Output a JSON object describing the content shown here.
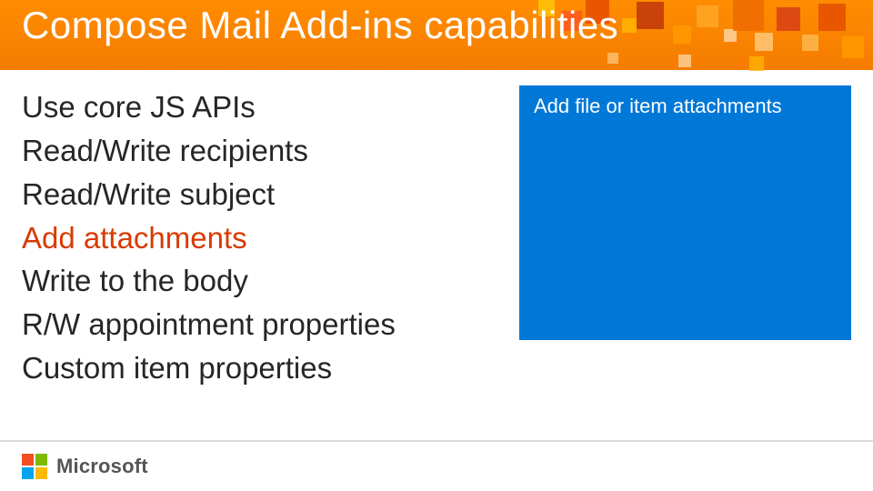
{
  "title": "Compose Mail Add-ins capabilities",
  "capabilities": [
    {
      "text": "Use core JS APIs",
      "highlight": false
    },
    {
      "text": "Read/Write recipients",
      "highlight": false
    },
    {
      "text": "Read/Write subject",
      "highlight": false
    },
    {
      "text": "Add attachments",
      "highlight": true
    },
    {
      "text": "Write to the body",
      "highlight": false
    },
    {
      "text": "R/W appointment properties",
      "highlight": false
    },
    {
      "text": "Custom item properties",
      "highlight": false
    }
  ],
  "panel": {
    "text": "Add file or item attachments"
  },
  "footer": {
    "brand": "Microsoft"
  }
}
